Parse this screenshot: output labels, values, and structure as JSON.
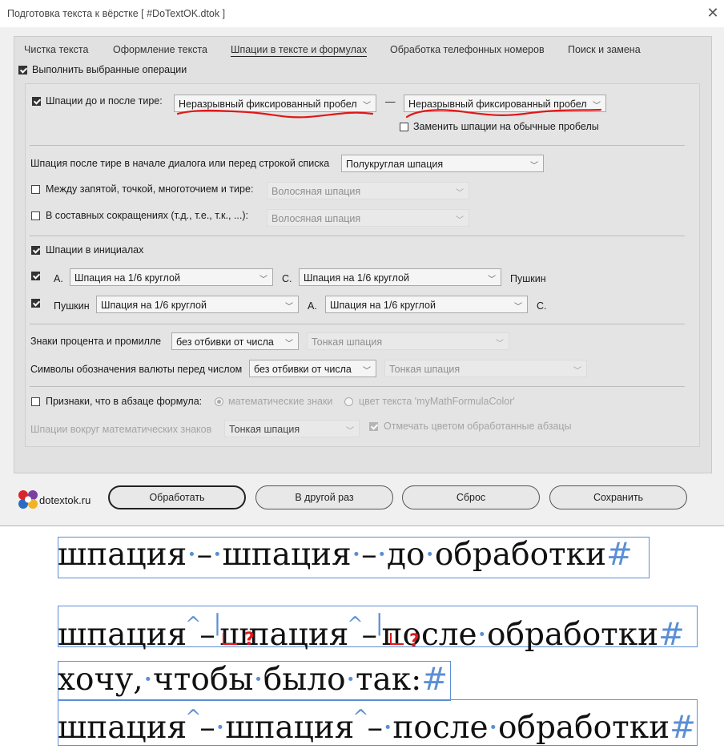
{
  "window": {
    "title": "Подготовка текста к вёрстке  [ #DoTextOK.dtok ]",
    "close_glyph": "✕"
  },
  "tabs": [
    {
      "label": "Чистка текста"
    },
    {
      "label": "Оформление текста"
    },
    {
      "label": "Шпации в тексте и формулах",
      "active": true
    },
    {
      "label": "Обработка телефонных номеров"
    },
    {
      "label": "Поиск и замена"
    }
  ],
  "run_selected": {
    "label": "Выполнить выбранные операции",
    "checked": true
  },
  "dash_spaces": {
    "label": "Шпации до и после тире:",
    "checked": true,
    "before_value": "Неразрывный фиксированный пробел",
    "dash": "—",
    "after_value": "Неразрывный фиксированный пробел",
    "replace_label": "Заменить шпации на обычные пробелы",
    "replace_checked": false
  },
  "dialog_dash": {
    "label": "Шпация после тире в начале диалога или перед строкой списка",
    "value": "Полукруглая шпация"
  },
  "between_punct": {
    "label": "Между запятой, точкой, многоточием и тире:",
    "checked": false,
    "value": "Волосяная шпация"
  },
  "abbreviations": {
    "label": "В составных сокращениях (т.д., т.е., т.к., ...):",
    "checked": false,
    "value": "Волосяная шпация"
  },
  "initials": {
    "label": "Шпации в инициалах",
    "checked": true,
    "row1": {
      "checked": true,
      "a": "А.",
      "sel1": "Шпация на 1/6 круглой",
      "b": "С.",
      "sel2": "Шпация на 1/6 круглой",
      "c": "Пушкин"
    },
    "row2": {
      "checked": true,
      "a": "Пушкин",
      "sel1": "Шпация на 1/6 круглой",
      "b": "А.",
      "sel2": "Шпация на 1/6 круглой",
      "c": "С."
    }
  },
  "percent": {
    "label": "Знаки процента и промилле",
    "value": "без отбивки от числа",
    "value2": "Тонкая шпация"
  },
  "currency": {
    "label": "Символы обозначения валюты перед числом",
    "value": "без отбивки от числа",
    "value2": "Тонкая шпация"
  },
  "formula": {
    "label": "Признаки, что в абзаце формула:",
    "checked": false,
    "radio1": "математические знаки",
    "radio2": "цвет текста 'myMathFormulaColor'",
    "math_spaces_label": "Шпации вокруг математических знаков",
    "math_spaces_value": "Тонкая шпация",
    "mark_label": "Отмечать цветом обработанные абзацы",
    "mark_checked": true
  },
  "logo": {
    "text": "dotextok.ru"
  },
  "buttons": {
    "process": "Обработать",
    "later": "В другой раз",
    "reset": "Сброс",
    "save": "Сохранить"
  },
  "samples": {
    "before": {
      "w1": "шпация",
      "dash1": "–",
      "w2": "шпация",
      "dash2": "–",
      "w3": "до",
      "w4": "обработки",
      "end": "#"
    },
    "after": {
      "w1": "шпация",
      "dash1": "–",
      "w2": "шпация",
      "dash2": "–",
      "w3": "после",
      "w4": "обработки",
      "end": "#",
      "question": "?"
    },
    "wish": {
      "w1": "хочу,",
      "w2": "чтобы",
      "w3": "было",
      "w4": "так:",
      "end": "#"
    },
    "desired": {
      "w1": "шпация",
      "dash1": "–",
      "w2": "шпация",
      "dash2": "–",
      "w3": "после",
      "w4": "обработки",
      "end": "#"
    }
  },
  "colors": {
    "accent": "#5b8fd6",
    "annotation": "#e01818"
  }
}
